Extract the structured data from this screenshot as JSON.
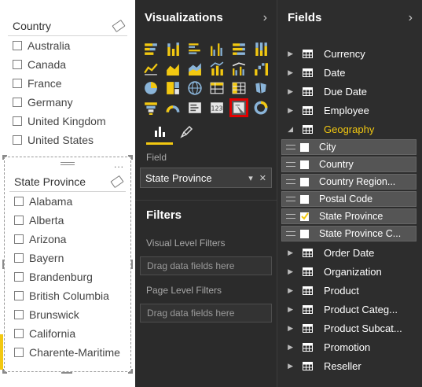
{
  "slicer_country": {
    "title": "Country",
    "items": [
      "Australia",
      "Canada",
      "France",
      "Germany",
      "United Kingdom",
      "United States"
    ]
  },
  "slicer_state": {
    "title": "State Province",
    "more": "...",
    "items": [
      "Alabama",
      "Alberta",
      "Arizona",
      "Bayern",
      "Brandenburg",
      "British Columbia",
      "Brunswick",
      "California",
      "Charente-Maritime"
    ]
  },
  "visualizations": {
    "title": "Visualizations",
    "chevron": "›",
    "icons": [
      "stacked-bar-chart-icon",
      "stacked-column-chart-icon",
      "clustered-bar-chart-icon",
      "clustered-column-chart-icon",
      "100-stacked-bar-chart-icon",
      "100-stacked-column-chart-icon",
      "line-chart-icon",
      "area-chart-icon",
      "stacked-area-chart-icon",
      "line-and-column-chart-icon",
      "line-and-clustered-column-icon",
      "waterfall-chart-icon",
      "pie-chart-icon",
      "treemap-icon",
      "map-icon",
      "table-icon",
      "matrix-icon",
      "filled-map-icon",
      "funnel-chart-icon",
      "gauge-icon",
      "multi-row-card-icon",
      "card-icon",
      "slicer-icon",
      "donut-chart-icon"
    ],
    "selected_icon_index": 22,
    "field_label": "Field",
    "field_value": "State Province",
    "filters_title": "Filters",
    "visual_level_filters": "Visual Level Filters",
    "page_level_filters": "Page Level Filters",
    "drop_placeholder": "Drag data fields here"
  },
  "fields": {
    "title": "Fields",
    "chevron": "›",
    "tables_before": [
      "Currency",
      "Date",
      "Due Date",
      "Employee"
    ],
    "expanded_table": "Geography",
    "geography_fields": [
      {
        "label": "City",
        "checked": false
      },
      {
        "label": "Country",
        "checked": false
      },
      {
        "label": "Country Region...",
        "checked": false
      },
      {
        "label": "Postal Code",
        "checked": false
      },
      {
        "label": "State Province",
        "checked": true
      },
      {
        "label": "State Province C...",
        "checked": false
      }
    ],
    "tables_after": [
      "Order Date",
      "Organization",
      "Product",
      "Product Categ...",
      "Product Subcat...",
      "Promotion",
      "Reseller"
    ]
  },
  "colors": {
    "accent_yellow": "#f2c811",
    "selected_border_red": "#e00000",
    "pane_dark": "#2b2b2b"
  }
}
